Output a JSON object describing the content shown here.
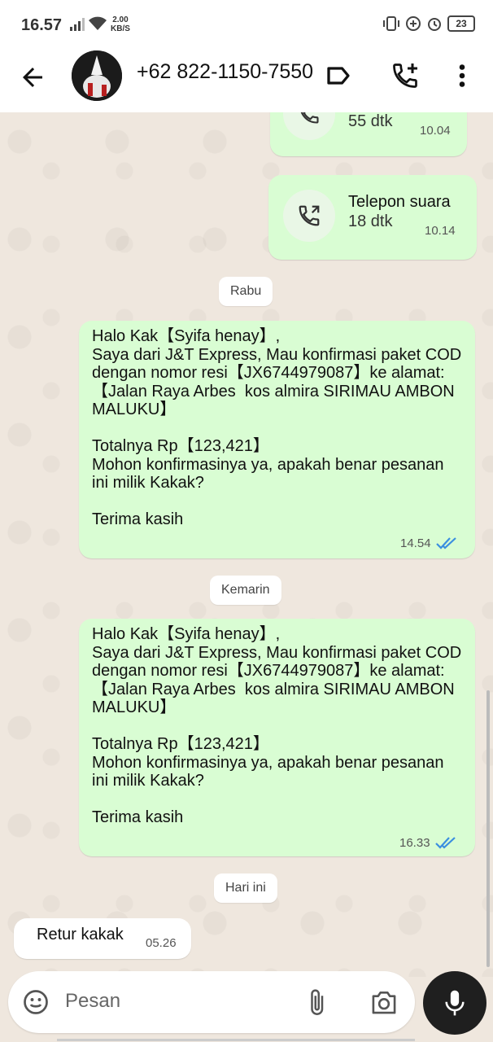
{
  "status_bar": {
    "time": "16.57",
    "speed_value": "2.00",
    "speed_unit": "KB/S",
    "battery": "23"
  },
  "header": {
    "contact_name": "+62 822-1150-7550"
  },
  "calls": [
    {
      "duration": "55 dtk",
      "time": "10.04"
    },
    {
      "title": "Telepon suara",
      "duration": "18 dtk",
      "time": "10.14"
    }
  ],
  "dates": {
    "rabu": "Rabu",
    "kemarin": "Kemarin",
    "hari_ini": "Hari ini"
  },
  "messages": [
    {
      "text": "Halo Kak【Syifa henay】,\nSaya dari J&T Express, Mau konfirmasi paket COD dengan nomor resi【JX6744979087】ke alamat:\n【Jalan Raya Arbes  kos almira SIRIMAU AMBON MALUKU】\n\nTotalnya Rp【123,421】\nMohon konfirmasinya ya, apakah benar pesanan ini milik Kakak?\n\nTerima kasih",
      "time": "14.54"
    },
    {
      "text": "Halo Kak【Syifa henay】,\nSaya dari J&T Express, Mau konfirmasi paket COD dengan nomor resi【JX6744979087】ke alamat:\n【Jalan Raya Arbes  kos almira SIRIMAU AMBON MALUKU】\n\nTotalnya Rp【123,421】\nMohon konfirmasinya ya, apakah benar pesanan ini milik Kakak?\n\nTerima kasih",
      "time": "16.33"
    },
    {
      "text": "Retur kakak",
      "time": "05.26"
    }
  ],
  "input": {
    "placeholder": "Pesan"
  },
  "colors": {
    "outgoing_bubble": "#d9fdd3",
    "incoming_bubble": "#ffffff",
    "read_ticks": "#3b8fe0",
    "chat_background": "#efe7de"
  },
  "icons": [
    "back-arrow-icon",
    "label-icon",
    "add-call-icon",
    "more-vert-icon",
    "call-icon",
    "double-check-icon",
    "emoji-icon",
    "attach-icon",
    "camera-icon",
    "mic-icon"
  ]
}
